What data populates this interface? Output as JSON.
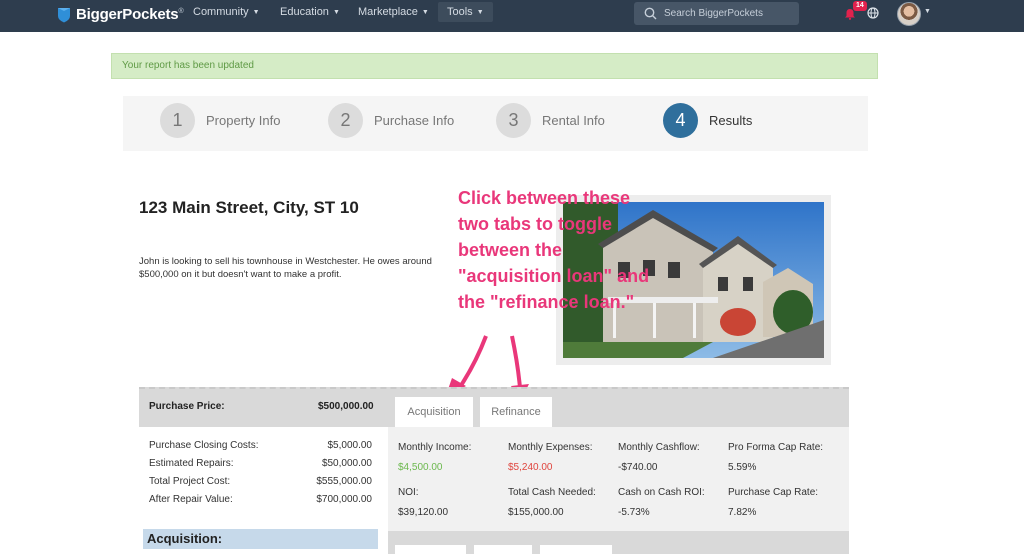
{
  "brand": {
    "name": "BiggerPockets",
    "mark": "®"
  },
  "nav": {
    "items": [
      {
        "label": "Community"
      },
      {
        "label": "Education"
      },
      {
        "label": "Marketplace"
      },
      {
        "label": "Tools"
      }
    ],
    "search_placeholder": "Search BiggerPockets",
    "notification_count": "14"
  },
  "alert": {
    "text": "Your report has been updated"
  },
  "steps": [
    {
      "number": "1",
      "label": "Property Info"
    },
    {
      "number": "2",
      "label": "Purchase Info"
    },
    {
      "number": "3",
      "label": "Rental Info"
    },
    {
      "number": "4",
      "label": "Results"
    }
  ],
  "property": {
    "address": "123 Main Street, City, ST 10",
    "description": "John is looking to sell his townhouse in Westchester. He owes around $500,000 on it but doesn't want to make a profit."
  },
  "annotation": {
    "text": "Click between these two tabs to toggle between the \"acquisition loan\" and the \"refinance loan.\""
  },
  "purchase": {
    "label": "Purchase Price:",
    "value": "$500,000.00"
  },
  "tabs": [
    {
      "label": "Acquisition"
    },
    {
      "label": "Refinance"
    }
  ],
  "costs": [
    {
      "label": "Purchase Closing Costs:",
      "value": "$5,000.00"
    },
    {
      "label": "Estimated Repairs:",
      "value": "$50,000.00"
    },
    {
      "label": "Total Project Cost:",
      "value": "$555,000.00"
    },
    {
      "label": "After Repair Value:",
      "value": "$700,000.00"
    }
  ],
  "acquisition_header": "Acquisition:",
  "metrics": [
    {
      "label": "Monthly Income:",
      "value": "$4,500.00",
      "tone": "green"
    },
    {
      "label": "Monthly Expenses:",
      "value": "$5,240.00",
      "tone": "red"
    },
    {
      "label": "Monthly Cashflow:",
      "value": "-$740.00",
      "tone": "normal"
    },
    {
      "label": "Pro Forma Cap Rate:",
      "value": "5.59%",
      "tone": "normal"
    },
    {
      "label": "NOI:",
      "value": "$39,120.00",
      "tone": "normal"
    },
    {
      "label": "Total Cash Needed:",
      "value": "$155,000.00",
      "tone": "normal"
    },
    {
      "label": "Cash on Cash ROI:",
      "value": "-5.73%",
      "tone": "normal"
    },
    {
      "label": "Purchase Cap Rate:",
      "value": "7.82%",
      "tone": "normal"
    }
  ],
  "colors": {
    "nav_bg": "#2e3d4e",
    "accent_blue": "#2f6f9c",
    "annotation_pink": "#e9377a",
    "positive_green": "#6cb84e",
    "negative_red": "#e0453e"
  }
}
